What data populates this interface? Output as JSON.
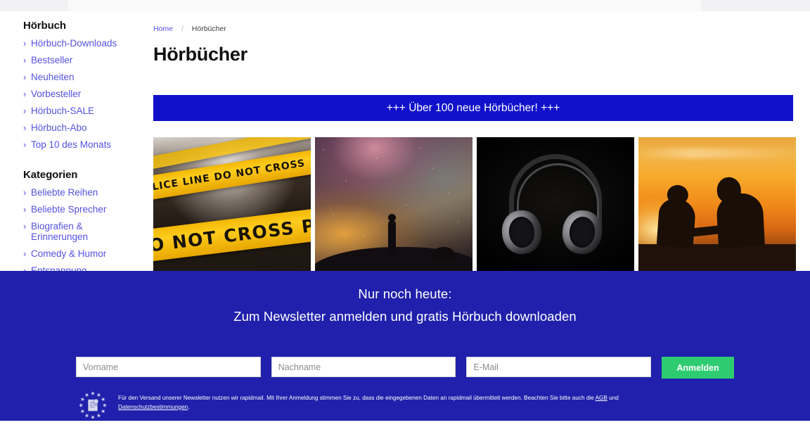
{
  "sidebar": {
    "sections": [
      {
        "heading": "Hörbuch",
        "items": [
          {
            "label": "Hörbuch-Downloads",
            "chevron": "›"
          },
          {
            "label": "Bestseller",
            "chevron": "›"
          },
          {
            "label": "Neuheiten",
            "chevron": "›"
          },
          {
            "label": "Vorbesteller",
            "chevron": "›"
          },
          {
            "label": "Hörbuch-SALE",
            "chevron": "›"
          },
          {
            "label": "Hörbuch-Abo",
            "chevron": "›"
          },
          {
            "label": "Top 10 des Monats",
            "chevron": "›"
          }
        ]
      },
      {
        "heading": "Kategorien",
        "items": [
          {
            "label": "Beliebte Reihen",
            "chevron": "›"
          },
          {
            "label": "Beliebte Sprecher",
            "chevron": "›"
          },
          {
            "label": "Biografien & Erinnerungen",
            "chevron": "›"
          },
          {
            "label": "Comedy & Humor",
            "chevron": "›"
          },
          {
            "label": "Entspannung",
            "chevron": "›"
          }
        ]
      }
    ]
  },
  "main": {
    "breadcrumb": {
      "home": "Home",
      "separator": "/",
      "current": "Hörbücher"
    },
    "page_title": "Hörbücher",
    "promo_banner": {
      "text": "+++ Über 100 neue Hörbücher! +++",
      "background": "#1111cc",
      "color": "#ffffff"
    },
    "thumbnails": [
      {
        "name": "police-tape-image",
        "alt": "Absperrband DO NOT CROSS POLICE LINE",
        "tape_top": "POLICE LINE DO NOT CROSS",
        "tape_main": "DO NOT CROSS POLI"
      },
      {
        "name": "starry-sky-image",
        "alt": "Silhouette unter Sternenhimmel"
      },
      {
        "name": "headphones-image",
        "alt": "Kopfhörer auf schwarzem Hintergrund"
      },
      {
        "name": "sunset-guitar-image",
        "alt": "Zwei Silhouetten mit Gitarre im Sonnenuntergang"
      }
    ]
  },
  "newsletter": {
    "headline_line1": "Nur noch heute:",
    "headline_line2": "Zum Newsletter anmelden und gratis Hörbuch downloaden",
    "background": "#2020ac",
    "fields": {
      "first_name": {
        "placeholder": "Vorname",
        "value": ""
      },
      "last_name": {
        "placeholder": "Nachname",
        "value": ""
      },
      "email": {
        "placeholder": "E-Mail",
        "value": ""
      }
    },
    "submit_label": "Anmelden",
    "submit_color": "#2ecc71",
    "legal": {
      "text_before": "Für den Versand unserer Newsletter nutzen wir rapidmail. Mit Ihrer Anmeldung stimmen Sie zu, dass die eingegebenen Daten an rapidmail übermittelt werden. Beachten Sie bitte auch die ",
      "link_agb": "AGB",
      "text_between": " und ",
      "link_privacy": "Datenschutzbestimmungen",
      "text_after": "."
    },
    "badge": {
      "name": "gdpr-eu-stars-badge",
      "label": "EU DSGVO"
    }
  }
}
